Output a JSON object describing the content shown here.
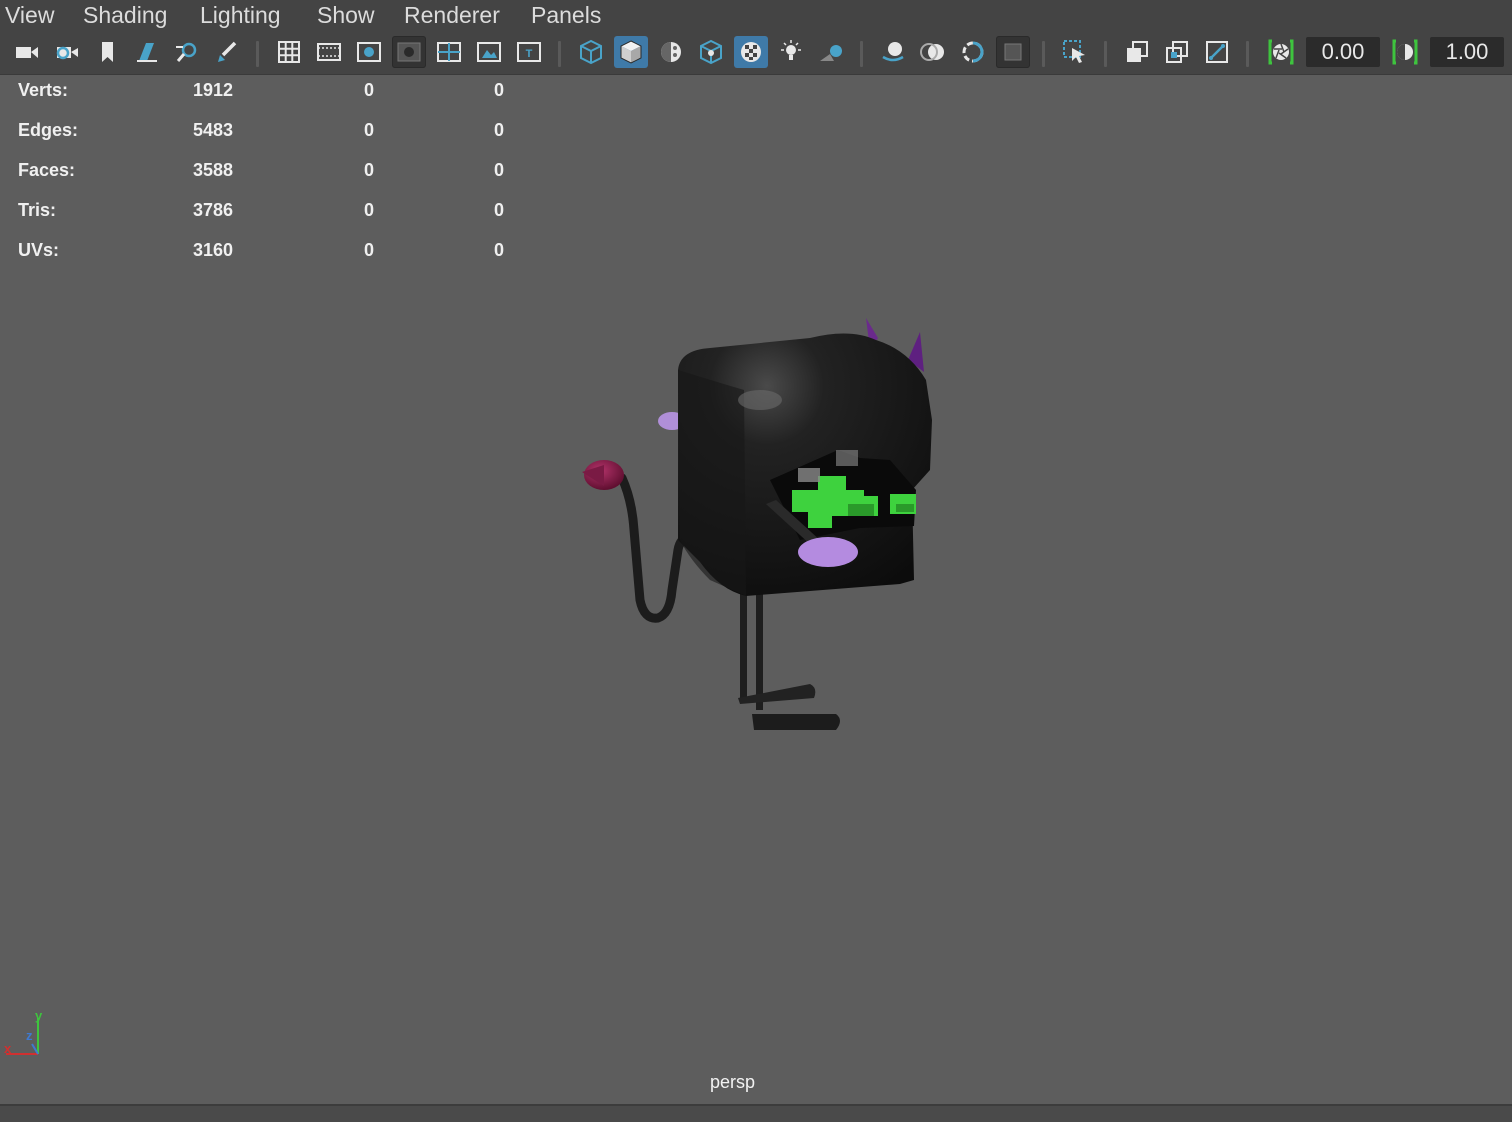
{
  "menu": {
    "items": [
      "View",
      "Shading",
      "Lighting",
      "Show",
      "Renderer",
      "Panels"
    ]
  },
  "toolbar": {
    "icons": [
      "camera-icon",
      "camera-attributes-icon",
      "bookmark-icon",
      "image-plane-icon",
      "grease-pencil-icon",
      "paint-brush-icon",
      "grid-icon",
      "film-gate-icon",
      "resolution-gate-icon",
      "gate-mask-icon",
      "field-chart-icon",
      "safe-action-icon",
      "safe-title-icon",
      "wireframe-icon",
      "smooth-shade-icon",
      "use-default-material-icon",
      "wireframe-on-shaded-icon",
      "textured-icon",
      "use-all-lights-icon",
      "shadows-icon",
      "screen-space-ao-icon",
      "motion-blur-icon",
      "multisample-aa-icon",
      "depth-of-field-icon",
      "isolate-select-icon",
      "xray-icon",
      "xray-active-components-icon",
      "xray-joints-icon",
      "exposure-icon",
      "gamma-icon"
    ],
    "exposure_value": "0.00",
    "gamma_value": "1.00",
    "accent_color": "#3f7aa8",
    "toggle_green": "#3ec43e"
  },
  "hud": {
    "rows": [
      {
        "label": "Verts:",
        "v1": "1912",
        "v2": "0",
        "v3": "0"
      },
      {
        "label": "Edges:",
        "v1": "5483",
        "v2": "0",
        "v3": "0"
      },
      {
        "label": "Faces:",
        "v1": "3588",
        "v2": "0",
        "v3": "0"
      },
      {
        "label": "Tris:",
        "v1": "3786",
        "v2": "0",
        "v3": "0"
      },
      {
        "label": "UVs:",
        "v1": "3160",
        "v2": "0",
        "v3": "0"
      }
    ]
  },
  "viewport": {
    "camera": "persp",
    "background_color": "#5d5d5d",
    "axis": {
      "x": "x",
      "y": "y",
      "z": "z"
    }
  }
}
